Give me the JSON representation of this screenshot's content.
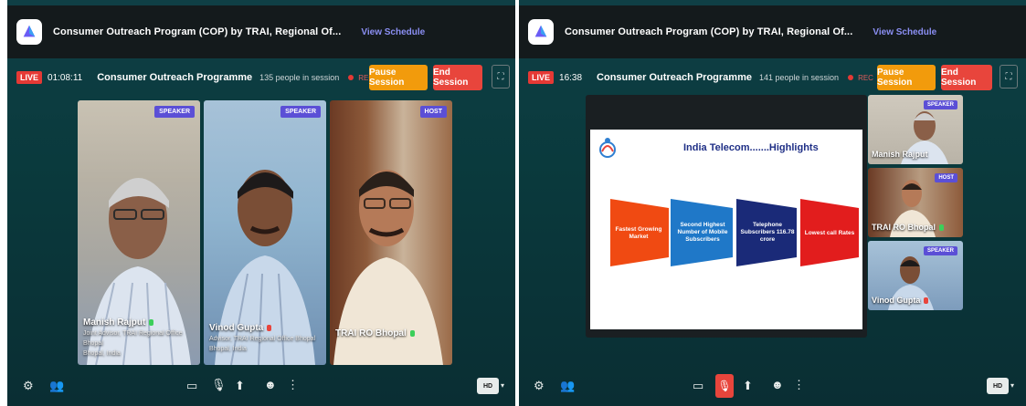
{
  "left": {
    "title": "Consumer Outreach Program (COP) by TRAI, Regional Of...",
    "schedule": "View Schedule",
    "live": "LIVE",
    "time": "01:08:11",
    "program": "Consumer Outreach Programme",
    "people": "135 people in session",
    "rec": "REC",
    "pause": "Pause Session",
    "end": "End Session",
    "tiles": [
      {
        "badge": "SPEAKER",
        "name": "Manish Rajput",
        "line1": "Joint Advisor, TRAI Regional Office",
        "line2": "Bhopal",
        "line3": "Bhopal, India"
      },
      {
        "badge": "SPEAKER",
        "name": "Vinod Gupta",
        "line1": "Advisor, TRAI Regional Office Bhopal",
        "line2": "Bhopal, India"
      },
      {
        "badge": "HOST",
        "name": "TRAI RO Bhopal"
      }
    ],
    "hd": "HD"
  },
  "right": {
    "title": "Consumer Outreach Program (COP) by TRAI, Regional Of...",
    "schedule": "View Schedule",
    "live": "LIVE",
    "time": "16:38",
    "program": "Consumer Outreach Programme",
    "people": "141 people in session",
    "rec": "REC",
    "pause": "Pause Session",
    "end": "End Session",
    "slide": {
      "title": "India Telecom.......Highlights",
      "boxes": [
        "Fastest Growing Market",
        "Second Highest Number of Mobile Subscribers",
        "Telephone Subscribers 116.78 crore",
        "Lowest call Rates"
      ]
    },
    "tiles": [
      {
        "badge": "SPEAKER",
        "name": "Manish Rajput"
      },
      {
        "badge": "HOST",
        "name": "TRAI RO Bhopal"
      },
      {
        "badge": "SPEAKER",
        "name": "Vinod Gupta"
      }
    ],
    "hd": "HD"
  },
  "colors": {
    "live": "#e53935",
    "pause": "#f29b0c",
    "end": "#e8453c",
    "badge": "#5b4fd6",
    "link": "#8b8ff3"
  }
}
